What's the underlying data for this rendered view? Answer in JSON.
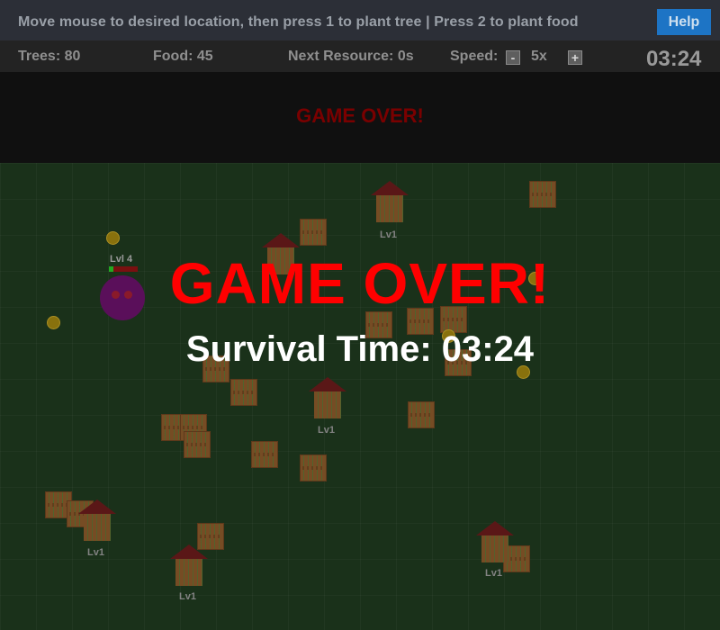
{
  "instructions": "Move mouse to desired location, then press 1 to plant tree | Press 2 to plant food",
  "help_label": "Help",
  "stats": {
    "trees": "Trees: 80",
    "food": "Food: 45",
    "next_resource": "Next Resource: 0s",
    "speed_label": "Speed:",
    "speed_minus": "-",
    "speed_value": "5x",
    "speed_plus": "+",
    "clock": "03:24"
  },
  "banner": {
    "text": "GAME OVER!"
  },
  "overlay": {
    "title": "GAME OVER!",
    "survival": "Survival Time: 03:24"
  },
  "monster": {
    "label": "Lvl 4",
    "hp_fraction": 0.15
  },
  "house_label": "Lv1",
  "colors": {
    "help": "#1d74c5",
    "game_over": "#ff0000",
    "field": "#1f3a1f"
  }
}
